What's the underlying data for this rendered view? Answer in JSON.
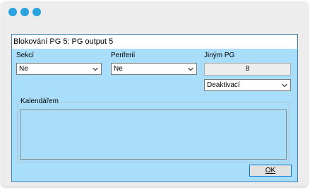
{
  "window": {
    "title": "Blokování PG 5: PG output 5"
  },
  "fields": {
    "sekci_label": "Sekcí",
    "sekci_value": "Ne",
    "periferii_label": "Periferií",
    "periferii_value": "Ne",
    "jinym_pg_label": "Jiným PG",
    "jinym_pg_value": "8",
    "jinym_pg_mode": "Deaktivací"
  },
  "calendar": {
    "label": "Kalendářem"
  },
  "buttons": {
    "ok_label": "OK"
  },
  "colors": {
    "dialog_background": "#a9defa",
    "window_dots": "#2aa3e0"
  }
}
